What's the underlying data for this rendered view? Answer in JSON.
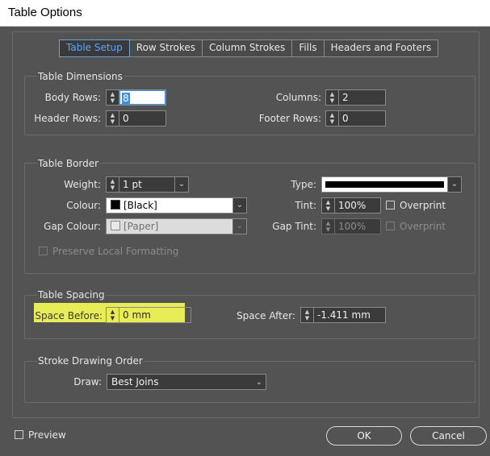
{
  "window": {
    "title": "Table Options"
  },
  "tabs": [
    "Table Setup",
    "Row Strokes",
    "Column Strokes",
    "Fills",
    "Headers and Footers"
  ],
  "dimensions": {
    "title": "Table Dimensions",
    "body_rows_label": "Body Rows:",
    "body_rows_value": "8",
    "header_rows_label": "Header Rows:",
    "header_rows_value": "0",
    "columns_label": "Columns:",
    "columns_value": "2",
    "footer_rows_label": "Footer Rows:",
    "footer_rows_value": "0"
  },
  "border": {
    "title": "Table Border",
    "weight_label": "Weight:",
    "weight_value": "1 pt",
    "type_label": "Type:",
    "colour_label": "Colour:",
    "colour_value": "[Black]",
    "tint_label": "Tint:",
    "tint_value": "100%",
    "overprint_label": "Overprint",
    "gap_colour_label": "Gap Colour:",
    "gap_colour_value": "[Paper]",
    "gap_tint_label": "Gap Tint:",
    "gap_tint_value": "100%",
    "gap_overprint_label": "Overprint",
    "preserve_label": "Preserve Local Formatting"
  },
  "spacing": {
    "title": "Table Spacing",
    "before_label": "Space Before:",
    "before_value": "0 mm",
    "after_label": "Space After:",
    "after_value": "-1.411 mm"
  },
  "stroke_order": {
    "title": "Stroke Drawing Order",
    "draw_label": "Draw:",
    "draw_value": "Best Joins"
  },
  "footer": {
    "preview_label": "Preview",
    "ok_label": "OK",
    "cancel_label": "Cancel"
  },
  "colors": {
    "accent": "#58a6ff",
    "highlight": "#e8ec57",
    "background": "#535353"
  }
}
